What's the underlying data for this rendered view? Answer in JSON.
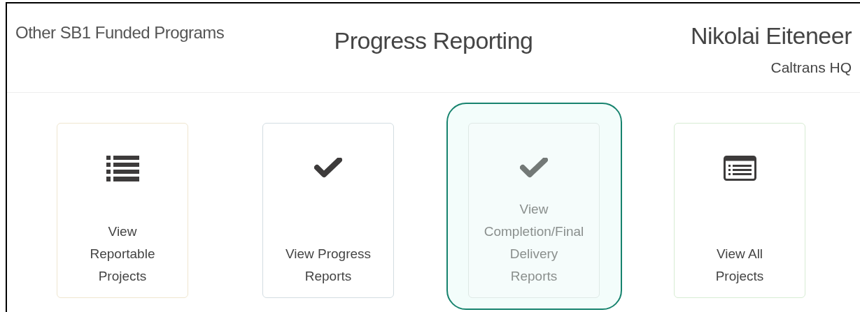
{
  "header": {
    "program": "Other SB1 Funded Programs",
    "title": "Progress Reporting",
    "user_name": "Nikolai Eiteneer",
    "user_org": "Caltrans HQ"
  },
  "cards": [
    {
      "kind": "list",
      "lines": [
        "View",
        "Reportable",
        "Projects"
      ],
      "color": "#efe6cf",
      "selected": false
    },
    {
      "kind": "check",
      "lines": [
        "View Progress",
        "Reports"
      ],
      "color": "#d3dde2",
      "selected": false
    },
    {
      "kind": "check",
      "lines": [
        "View",
        "Completion/Final",
        "Delivery",
        "Reports"
      ],
      "color": "#dfe9e6",
      "selected": true
    },
    {
      "kind": "table",
      "lines": [
        "View All",
        "Projects"
      ],
      "color": "#d7ecd3",
      "selected": false
    }
  ]
}
